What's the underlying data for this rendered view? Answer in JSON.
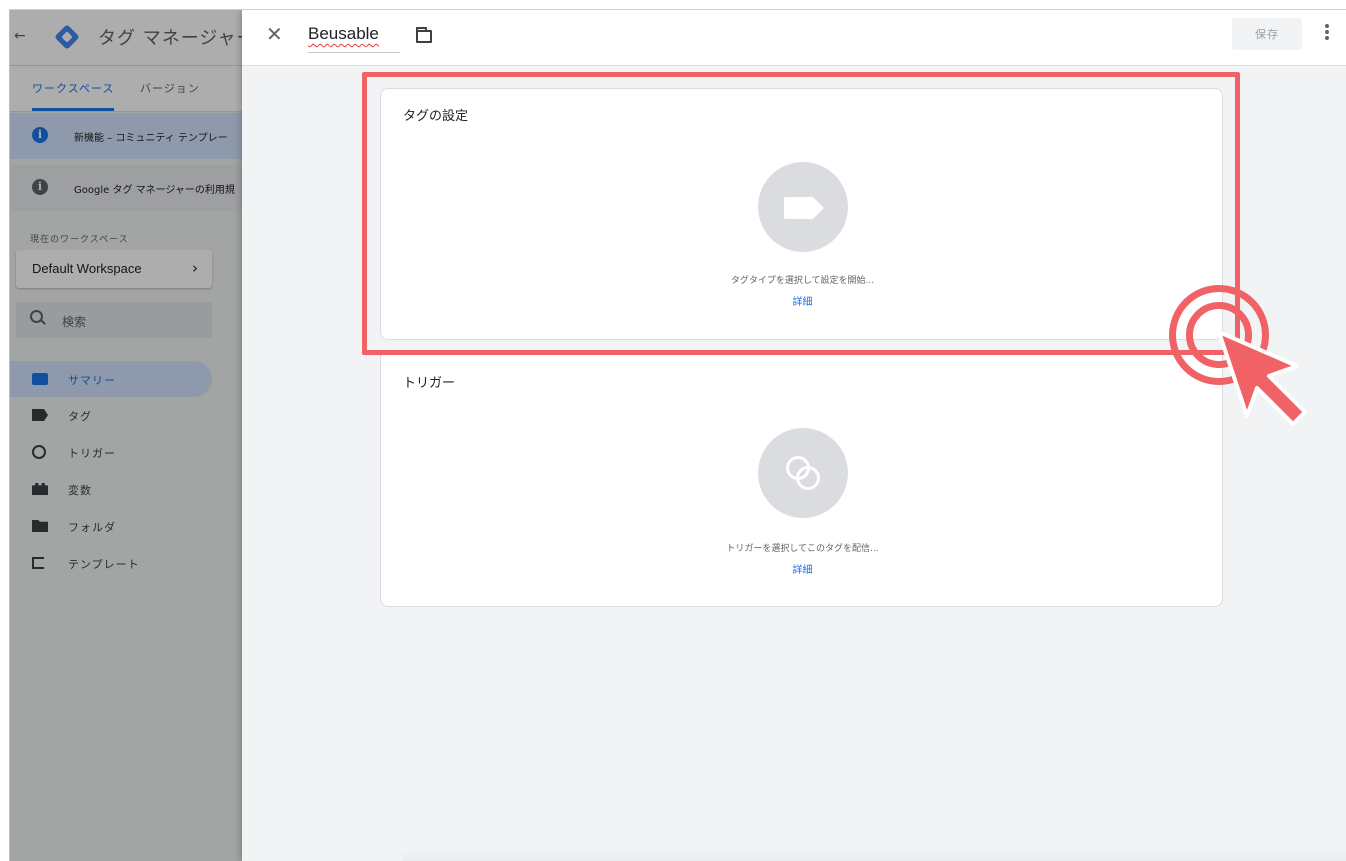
{
  "sidebar": {
    "app_title": "タグ マネージャー",
    "tabs": {
      "workspace": "ワークスペース",
      "versions": "バージョン"
    },
    "notices": [
      {
        "text": "新機能 – コミュニティ テンプレー"
      },
      {
        "text": "Google タグ マネージャーの利用規"
      }
    ],
    "workspace_label": "現在のワークスペース",
    "workspace_name": "Default Workspace",
    "search_placeholder": "検索",
    "nav": [
      {
        "label": "サマリー",
        "icon": "summary-icon",
        "active": true
      },
      {
        "label": "タグ",
        "icon": "tag-icon"
      },
      {
        "label": "トリガー",
        "icon": "trigger-icon"
      },
      {
        "label": "変数",
        "icon": "variables-icon"
      },
      {
        "label": "フォルダ",
        "icon": "folder-icon"
      },
      {
        "label": "テンプレート",
        "icon": "template-icon"
      }
    ]
  },
  "editor": {
    "tag_name": "Beusable",
    "save_label": "保存",
    "tag_config": {
      "title": "タグの設定",
      "hint": "タグタイプを選択して設定を開始...",
      "link": "詳細"
    },
    "triggering": {
      "title": "トリガー",
      "hint": "トリガーを選択してこのタグを配信...",
      "link": "詳細"
    }
  },
  "annotation": {
    "highlight_color": "#f06265"
  }
}
